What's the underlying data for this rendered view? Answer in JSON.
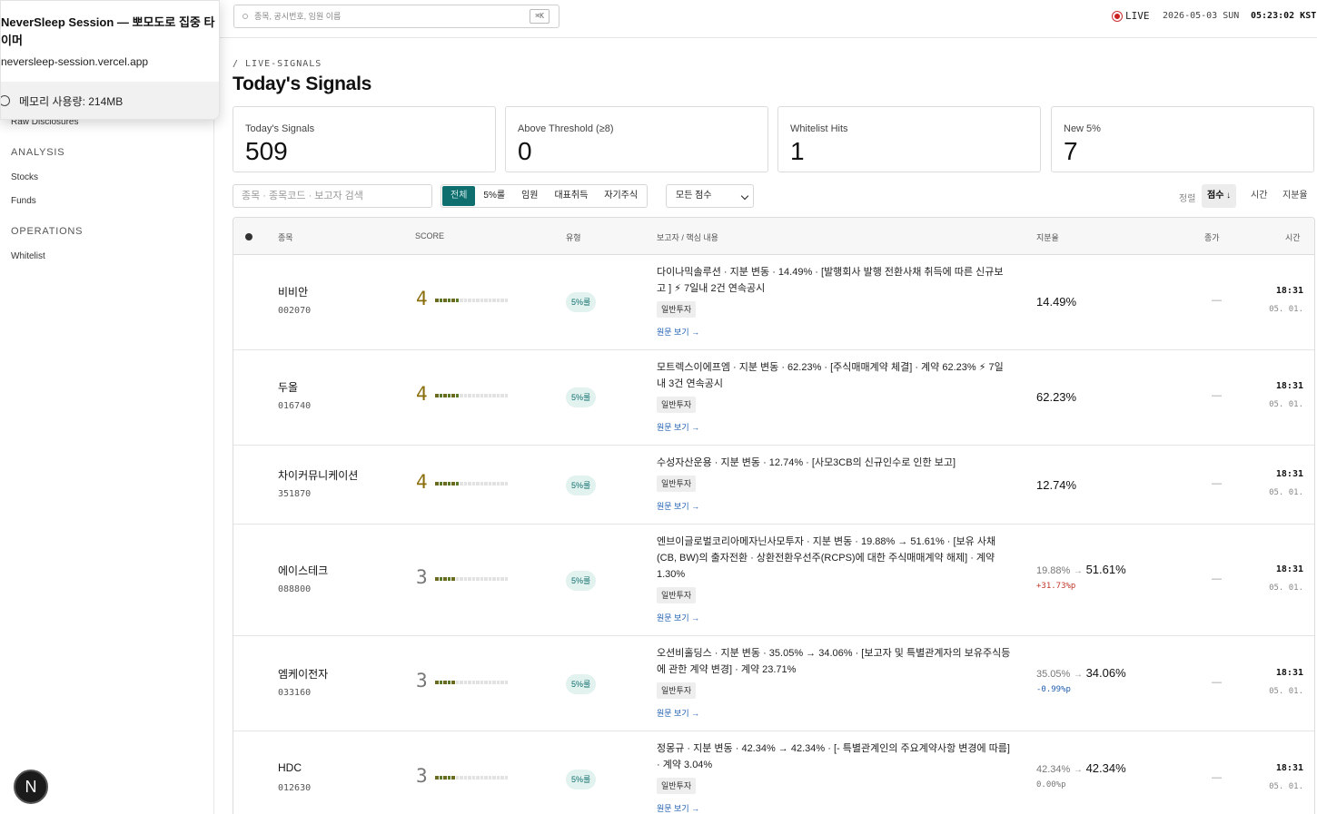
{
  "browser_popup": {
    "title_line1": "NeverSleep Session — 뽀모도로 집중 타",
    "title_line2": "이머",
    "url": "neversleep-session.vercel.app",
    "memory": "메모리 사용량: 214MB"
  },
  "sidebar": {
    "partial_item": "Raw Disclosures",
    "section_analysis": "ANALYSIS",
    "item_stocks": "Stocks",
    "item_funds": "Funds",
    "section_operations": "OPERATIONS",
    "item_whitelist": "Whitelist",
    "avatar_letter": "N"
  },
  "topbar": {
    "search_placeholder": "종목, 공시번호, 임원 이름",
    "search_shortcut": "⌘K",
    "live_label": "LIVE",
    "date": "2026-05-03 SUN",
    "clock": "05:23:02 KST"
  },
  "header": {
    "breadcrumb": "/ LIVE-SIGNALS",
    "title": "Today's Signals"
  },
  "stats": [
    {
      "label": "Today's Signals",
      "value": "509"
    },
    {
      "label": "Above Threshold (≥8)",
      "value": "0"
    },
    {
      "label": "Whitelist Hits",
      "value": "1"
    },
    {
      "label": "New 5%",
      "value": "7"
    }
  ],
  "filters": {
    "search_placeholder": "종목 · 종목코드 · 보고자 검색",
    "segments": [
      "전체",
      "5%룰",
      "임원",
      "대표취득",
      "자기주식"
    ],
    "score_select": "모든 점수",
    "sort_label": "정렬",
    "sort_options": [
      "점수 ↓",
      "시간",
      "지분율"
    ]
  },
  "table": {
    "headers": {
      "stock": "종목",
      "score": "SCORE",
      "type": "유형",
      "reporter": "보고자 / 핵심 내용",
      "ratio": "지분율",
      "price": "종가",
      "time": "시간"
    },
    "rows": [
      {
        "name": "비비안",
        "code": "002070",
        "score": "4",
        "score_level": 4,
        "score_color": "#8a6d0b",
        "type": "5%룰",
        "desc": "다이나믹솔루션 · 지분 변동 · 14.49% · [발행회사 발행 전환사채 취득에 따른 신규보고 ] ⚡ 7일내 2건 연속공시",
        "tag": "일반투자",
        "link": "원문 보기 →",
        "ratio_from": "",
        "ratio_arrow": "",
        "ratio": "14.49%",
        "delta": "",
        "delta_color": "",
        "price": "—",
        "time": "18:31",
        "date": "05. 01."
      },
      {
        "name": "두올",
        "code": "016740",
        "score": "4",
        "score_level": 4,
        "score_color": "#8a6d0b",
        "type": "5%룰",
        "desc": "모트렉스이에프엠 · 지분 변동 · 62.23% · [주식매매계약 체결] · 계약 62.23% ⚡ 7일내 3건 연속공시",
        "tag": "일반투자",
        "link": "원문 보기 →",
        "ratio_from": "",
        "ratio_arrow": "",
        "ratio": "62.23%",
        "delta": "",
        "delta_color": "",
        "price": "—",
        "time": "18:31",
        "date": "05. 01."
      },
      {
        "name": "차이커뮤니케이션",
        "code": "351870",
        "score": "4",
        "score_level": 4,
        "score_color": "#8a6d0b",
        "type": "5%룰",
        "desc": "수성자산운용 · 지분 변동 · 12.74% · [사모3CB의 신규인수로 인한 보고]",
        "tag": "일반투자",
        "link": "원문 보기 →",
        "ratio_from": "",
        "ratio_arrow": "",
        "ratio": "12.74%",
        "delta": "",
        "delta_color": "",
        "price": "—",
        "time": "18:31",
        "date": "05. 01."
      },
      {
        "name": "에이스테크",
        "code": "088800",
        "score": "3",
        "score_level": 3,
        "score_color": "#777777",
        "type": "5%룰",
        "desc": "엔브이글로벌코리아메자닌사모투자 · 지분 변동 · 19.88% → 51.61% · [보유 사채(CB, BW)의 출자전환 · 상환전환우선주(RCPS)에 대한 주식매매계약 해제] · 계약 1.30%",
        "tag": "일반투자",
        "link": "원문 보기 →",
        "ratio_from": "19.88%",
        "ratio_arrow": "→",
        "ratio": "51.61%",
        "delta": "+31.73%p",
        "delta_color": "#c0392b",
        "price": "—",
        "time": "18:31",
        "date": "05. 01."
      },
      {
        "name": "엠케이전자",
        "code": "033160",
        "score": "3",
        "score_level": 3,
        "score_color": "#777777",
        "type": "5%룰",
        "desc": "오션비홀딩스 · 지분 변동 · 35.05% → 34.06% · [보고자 및 특별관계자의 보유주식등에 관한 계약 변경] · 계약 23.71%",
        "tag": "일반투자",
        "link": "원문 보기 →",
        "ratio_from": "35.05%",
        "ratio_arrow": "→",
        "ratio": "34.06%",
        "delta": "-0.99%p",
        "delta_color": "#1f5fb0",
        "price": "—",
        "time": "18:31",
        "date": "05. 01."
      },
      {
        "name": "HDC",
        "code": "012630",
        "score": "3",
        "score_level": 3,
        "score_color": "#777777",
        "type": "5%룰",
        "desc": "정몽규 · 지분 변동 · 42.34% → 42.34% · [- 특별관계인의 주요계약사항 변경에 따름] · 계약 3.04%",
        "tag": "일반투자",
        "link": "원문 보기 →",
        "ratio_from": "42.34%",
        "ratio_arrow": "→",
        "ratio": "42.34%",
        "delta": "0.00%p",
        "delta_color": "#777777",
        "price": "—",
        "time": "18:31",
        "date": "05. 01."
      }
    ]
  }
}
